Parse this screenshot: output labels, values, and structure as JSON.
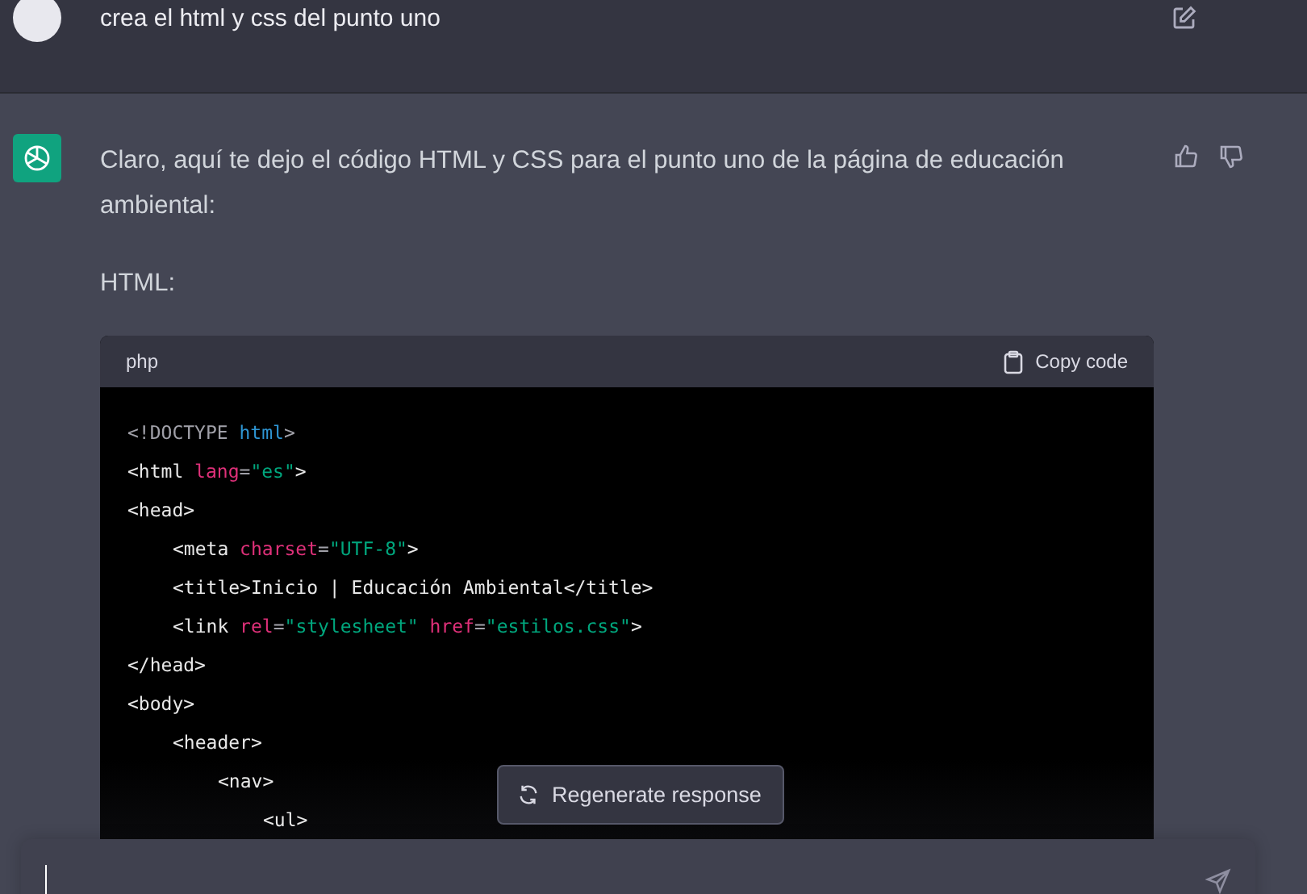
{
  "user_message": {
    "text": "crea el html y css del punto uno"
  },
  "assistant_message": {
    "paragraphs": [
      "Claro, aquí te dejo el código HTML y CSS para el punto uno de la página de educación ambiental:",
      "HTML:"
    ],
    "code_block": {
      "language": "php",
      "copy_label": "Copy code",
      "lines": [
        {
          "tokens": [
            {
              "kind": "punct",
              "text": "<!DOCTYPE "
            },
            {
              "kind": "keyword",
              "text": "html"
            },
            {
              "kind": "punct",
              "text": ">"
            }
          ]
        },
        {
          "tokens": [
            {
              "kind": "tag",
              "text": "<html"
            },
            {
              "kind": "attr",
              "text": " lang"
            },
            {
              "kind": "punct",
              "text": "="
            },
            {
              "kind": "string",
              "text": "\"es\""
            },
            {
              "kind": "tag",
              "text": ">"
            }
          ]
        },
        {
          "tokens": [
            {
              "kind": "tag",
              "text": "<head>"
            }
          ],
          "children": [
            {
              "tokens": [
                {
                  "kind": "tag",
                  "text": "<meta"
                },
                {
                  "kind": "attr",
                  "text": " charset"
                },
                {
                  "kind": "punct",
                  "text": "="
                },
                {
                  "kind": "string",
                  "text": "\"UTF-8\""
                },
                {
                  "kind": "tag",
                  "text": ">"
                }
              ]
            },
            {
              "tokens": [
                {
                  "kind": "tag",
                  "text": "<title>Inicio | Educación Ambiental</title>"
                }
              ]
            },
            {
              "tokens": [
                {
                  "kind": "tag",
                  "text": "<link"
                },
                {
                  "kind": "attr",
                  "text": " rel"
                },
                {
                  "kind": "punct",
                  "text": "="
                },
                {
                  "kind": "string",
                  "text": "\"stylesheet\""
                },
                {
                  "kind": "attr",
                  "text": " href"
                },
                {
                  "kind": "punct",
                  "text": "="
                },
                {
                  "kind": "string",
                  "text": "\"estilos.css\""
                },
                {
                  "kind": "tag",
                  "text": ">"
                }
              ]
            }
          ]
        },
        {
          "tokens": [
            {
              "kind": "tag",
              "text": "</head>"
            }
          ]
        },
        {
          "tokens": [
            {
              "kind": "tag",
              "text": "<body>"
            }
          ],
          "children": [
            {
              "tokens": [
                {
                  "kind": "tag",
                  "text": "<header>"
                }
              ],
              "children": [
                {
                  "tokens": [
                    {
                      "kind": "tag",
                      "text": "<nav>"
                    }
                  ],
                  "children": [
                    {
                      "tokens": [
                        {
                          "kind": "tag",
                          "text": "<ul>"
                        }
                      ]
                    }
                  ]
                }
              ]
            }
          ]
        }
      ]
    }
  },
  "regenerate_button": {
    "label": "Regenerate response"
  }
}
